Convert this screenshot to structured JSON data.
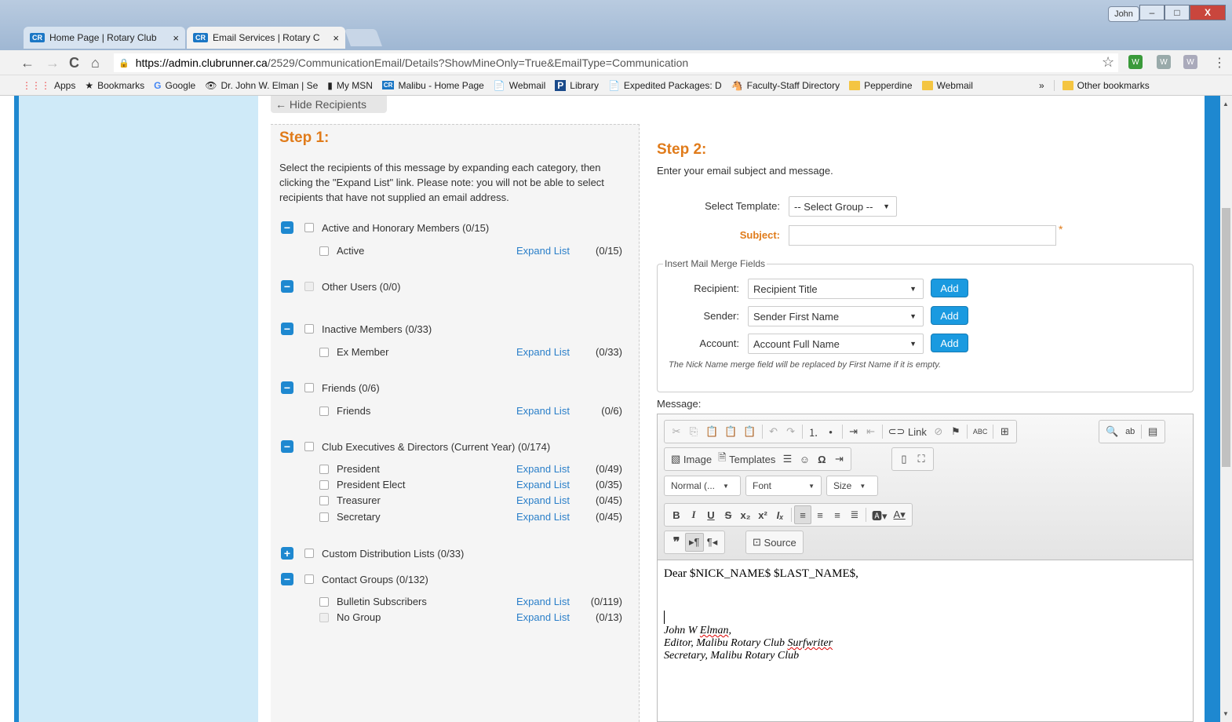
{
  "browser": {
    "tabs": [
      {
        "icon": "CR",
        "label": "Home Page | Rotary Club",
        "close": "×"
      },
      {
        "icon": "CR",
        "label": "Email Services | Rotary C",
        "close": "×"
      }
    ],
    "user_button": "John",
    "window_buttons": {
      "minimize": "–",
      "maximize": "□",
      "close": "X"
    },
    "url_host": "https://admin.clubrunner.ca",
    "url_path": "/2529/CommunicationEmail/Details?ShowMineOnly=True&EmailType=Communication",
    "nav": {
      "back": "←",
      "forward": "→",
      "reload": "C",
      "home": "⌂"
    },
    "star": "☆",
    "extensions": [
      "W",
      "W",
      "W"
    ],
    "bookmarks": [
      {
        "icon": "⋮⋮⋮",
        "label": "Apps"
      },
      {
        "icon": "★",
        "label": "Bookmarks"
      },
      {
        "icon": "G",
        "label": "Google"
      },
      {
        "icon": "👁",
        "label": "Dr. John W. Elman | Se"
      },
      {
        "icon": "▮",
        "label": "My MSN"
      },
      {
        "icon": "CR",
        "label": "Malibu - Home Page"
      },
      {
        "icon": "📄",
        "label": "Webmail"
      },
      {
        "icon": "P",
        "label": "Library"
      },
      {
        "icon": "📄",
        "label": "Expedited Packages: D"
      },
      {
        "icon": "🐴",
        "label": "Faculty-Staff Directory"
      },
      {
        "icon": "folder",
        "label": "Pepperdine"
      },
      {
        "icon": "folder",
        "label": "Webmail"
      }
    ],
    "more_bookmarks": "»",
    "other_bookmarks": "Other bookmarks"
  },
  "hide_recipients": "← Hide Recipients",
  "step1": {
    "title": "Step 1:",
    "description": "Select the recipients of this message by expanding each category, then clicking the \"Expand List\" link. Please note: you will not be able to select recipients that have not supplied an email address.",
    "expand_label": "Expand List",
    "categories": [
      {
        "toggle": "−",
        "label": "Active and Honorary Members (0/15)",
        "items": [
          {
            "label": "Active",
            "count": "(0/15)"
          }
        ]
      },
      {
        "toggle": "−",
        "label": "Other Users (0/0)",
        "items": []
      },
      {
        "toggle": "−",
        "label": "Inactive Members (0/33)",
        "items": [
          {
            "label": "Ex Member",
            "count": "(0/33)"
          }
        ]
      },
      {
        "toggle": "−",
        "label": "Friends (0/6)",
        "items": [
          {
            "label": "Friends",
            "count": "(0/6)"
          }
        ]
      },
      {
        "toggle": "−",
        "label": "Club Executives & Directors (Current Year) (0/174)",
        "items": [
          {
            "label": "President",
            "count": "(0/49)"
          },
          {
            "label": "President Elect",
            "count": "(0/35)"
          },
          {
            "label": "Treasurer",
            "count": "(0/45)"
          },
          {
            "label": "Secretary",
            "count": "(0/45)"
          }
        ]
      },
      {
        "toggle": "+",
        "label": "Custom Distribution Lists (0/33)",
        "items": []
      },
      {
        "toggle": "−",
        "label": "Contact Groups (0/132)",
        "items": [
          {
            "label": "Bulletin Subscribers",
            "count": "(0/119)"
          },
          {
            "label": "No Group",
            "count": "(0/13)"
          }
        ]
      }
    ]
  },
  "step2": {
    "title": "Step 2:",
    "description": "Enter your email subject and message.",
    "template_label": "Select Template:",
    "template_value": "-- Select Group --",
    "subject_label": "Subject:",
    "subject_value": "",
    "required_mark": "*",
    "merge_legend": "Insert Mail Merge Fields",
    "merge_rows": [
      {
        "label": "Recipient:",
        "value": "Recipient Title"
      },
      {
        "label": "Sender:",
        "value": "Sender First Name"
      },
      {
        "label": "Account:",
        "value": "Account Full Name"
      }
    ],
    "add_label": "Add",
    "merge_note": "The Nick Name merge field will be replaced by First Name if it is empty.",
    "message_label": "Message:"
  },
  "editor": {
    "toolbar_row1": [
      "✂",
      "⎘",
      "📋",
      "📋",
      "📋",
      "↶",
      "↷",
      "⒈",
      "•",
      "⇥",
      "⇤",
      "Link",
      "⚑",
      "ABC",
      "⊞",
      "🔍",
      "ab",
      "▤"
    ],
    "image_label": "Image",
    "templates_label": "Templates",
    "format_combo": "Normal (...",
    "font_combo": "Font",
    "size_combo": "Size",
    "source_label": "Source",
    "body_greeting": "Dear $NICK_NAME$ $LAST_NAME$,",
    "sig_line1_a": "John W ",
    "sig_line1_b": "Elman",
    "sig_line1_c": ",",
    "sig_line2_a": "Editor, Malibu Rotary Club ",
    "sig_line2_b": "Surfwriter",
    "sig_line3": "Secretary, Malibu Rotary Club"
  }
}
